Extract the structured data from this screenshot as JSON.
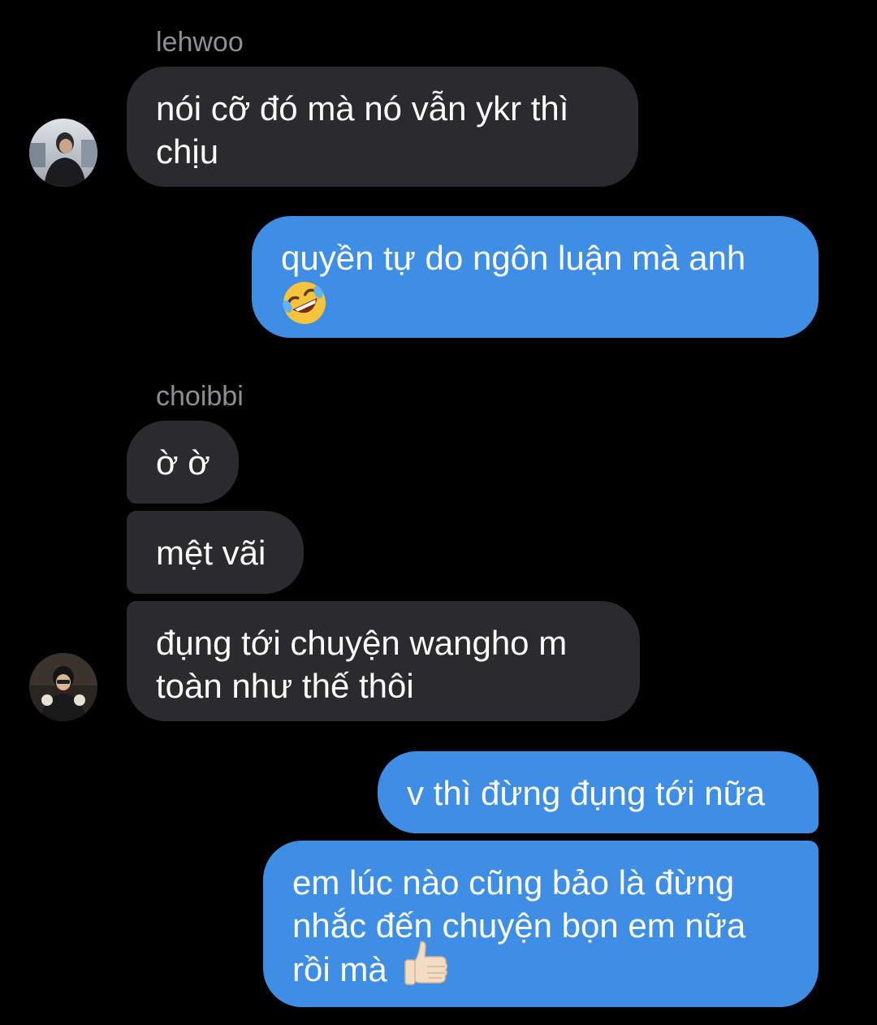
{
  "thread": {
    "group1": {
      "sender": "lehwoo",
      "messages": [
        {
          "lines": [
            "nói cỡ đó mà nó vẫn ykr thì",
            "chịu"
          ]
        }
      ],
      "avatar": "lehwoo-avatar"
    },
    "out1": {
      "messages": [
        {
          "line1": "quyền tự do ngôn luận mà anh",
          "emoji": "rolling-on-floor-laughing-emoji"
        }
      ]
    },
    "group2": {
      "sender": "choibbi",
      "messages": [
        {
          "text": "ờ ờ"
        },
        {
          "text": "mệt vãi"
        },
        {
          "lines": [
            "đụng tới chuyện wangho m",
            "toàn như thế thôi"
          ]
        }
      ],
      "avatar": "choibbi-avatar"
    },
    "out2": {
      "messages": [
        {
          "text": "v thì đừng đụng tới nữa"
        },
        {
          "lines": [
            "em lúc nào cũng bảo là đừng",
            "nhắc đến chuyện bọn em nữa",
            "rồi mà"
          ],
          "emoji": "thumbs-up-emoji"
        }
      ]
    }
  },
  "colors": {
    "background": "#000000",
    "incoming_bubble": "#2b2b2d",
    "outgoing_bubble": "#3f8ee6",
    "sender_name": "#8e8e93"
  }
}
